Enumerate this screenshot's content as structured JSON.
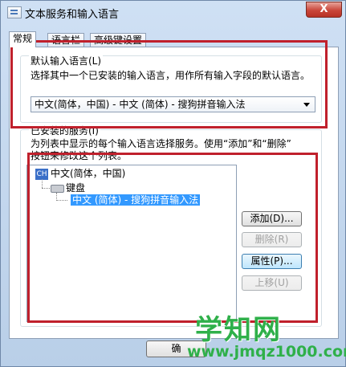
{
  "window": {
    "title": "文本服务和输入语言",
    "close_label": "X"
  },
  "tabs": [
    {
      "label": "常规"
    },
    {
      "label": "语言栏"
    },
    {
      "label": "高级键设置"
    }
  ],
  "default_language": {
    "title": "默认输入语言(L)",
    "description": "选择其中一个已安装的输入语言，用作所有输入字段的默认语言。",
    "selected": "中文(简体，中国) - 中文 (简体) - 搜狗拼音输入法"
  },
  "installed_services": {
    "title": "已安装的服务(I)",
    "description_line1": "为列表中显示的每个输入语言选择服务。使用“添加”和“删除”",
    "description_line2": "按钮来修改这个列表。",
    "tree": {
      "language_badge": "CH",
      "language": "中文(简体，中国)",
      "category": "键盘",
      "service": "中文 (简体) - 搜狗拼音输入法"
    },
    "buttons": {
      "add": "添加(D)...",
      "remove": "删除(R)",
      "properties": "属性(P)...",
      "move_up": "上移(U)"
    }
  },
  "footer": {
    "ok_label": "确"
  },
  "watermark": {
    "brand": "学知网",
    "url": "www.jmqz1000.com"
  },
  "colors": {
    "highlight_box": "#c0202c",
    "selection": "#3399ff",
    "watermark": "#2fb04a"
  }
}
